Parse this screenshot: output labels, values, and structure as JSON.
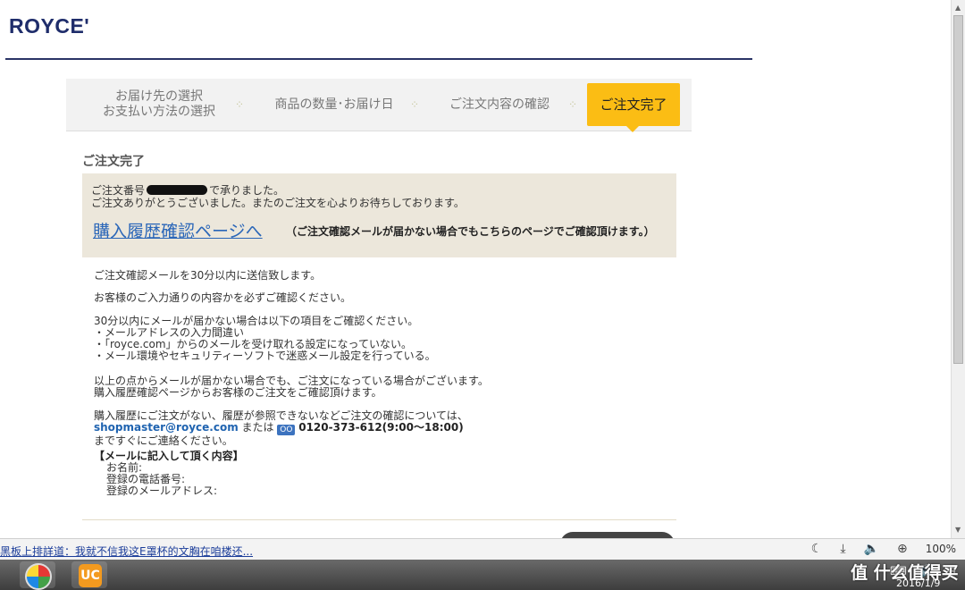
{
  "brand": {
    "logo": "ROYCE'"
  },
  "steps": {
    "step1": "お届け先の選択\nお支払い方法の選択",
    "step1_a": "お届け先の選択",
    "step1_b": "お支払い方法の選択",
    "step2": "商品の数量･お届け日",
    "step3": "ご注文内容の確認",
    "step4_active": "ご注文完了",
    "separator": "⁘"
  },
  "section": {
    "title": "ご注文完了"
  },
  "notice": {
    "order_prefix": "ご注文番号",
    "order_suffix": "で承りました。",
    "thanks": "ご注文ありがとうございました。またのご注文を心よりお待ちしております。",
    "history_link": "購入履歴確認ページへ",
    "history_note": "（ご注文確認メールが届かない場合でもこちらのページでご確認頂けます。）"
  },
  "body": {
    "p1": "ご注文確認メールを30分以内に送信致します。",
    "p2": "お客様のご入力通りの内容かを必ずご確認ください。",
    "p3_l1": "30分以内にメールが届かない場合は以下の項目をご確認ください。",
    "p3_l2": "・メールアドレスの入力間違い",
    "p3_l3": "・「royce.com」からのメールを受け取れる設定になっていない。",
    "p3_l4": "・メール環境やセキュリティーソフトで迷惑メール設定を行っている。",
    "p4_l1": "以上の点からメールが届かない場合でも、ご注文になっている場合がございます。",
    "p4_l2": "購入履歴確認ページからお客様のご注文をご確認頂けます。",
    "p5_l1": "購入履歴にご注文がない、履歴が参照できないなどご注文の確認については、",
    "email": "shopmaster@royce.com",
    "or": "または",
    "tel_icon": "OO",
    "tel": "0120-373-612(9:00～18:00)",
    "p5_l3": "まですぐにご連絡ください。",
    "mail_heading": "【メールに記入して頂く内容】",
    "field_name": "お名前:",
    "field_phone": "登録の電話番号:",
    "field_email": "登録のメールアドレス:"
  },
  "statusbar": {
    "news": "黑板上排詳道：我就不信我这E罩杯的文胸在咱楼还...",
    "zoom": "100%"
  },
  "taskbar": {
    "uc_label": "UC",
    "watermark": "值 什么值得买",
    "date": "2016/1/9"
  }
}
